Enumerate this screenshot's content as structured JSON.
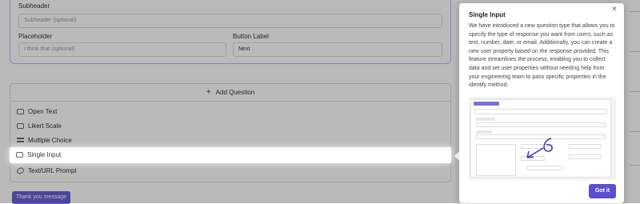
{
  "form": {
    "subheader_label": "Subheader",
    "subheader_placeholder": "Subheader (optional)",
    "placeholder_label": "Placeholder",
    "placeholder_placeholder": "I think that (optional)",
    "button_label_label": "Button Label",
    "button_label_value": "Next"
  },
  "question_types": {
    "add_question_label": "Add Question",
    "items": [
      {
        "label": "Open Text",
        "icon": "text-box-icon"
      },
      {
        "label": "Likert Scale",
        "icon": "scale-icon"
      },
      {
        "label": "Multiple Choice",
        "icon": "list-icon"
      },
      {
        "label": "Single Input",
        "icon": "input-icon"
      },
      {
        "label": "Text/URL Prompt",
        "icon": "link-icon"
      }
    ]
  },
  "thank_you_button": "Thank you message",
  "popover": {
    "title": "Single Input",
    "body": "We have introduced a new question type that allows you to specify the type of response you want from users, such as text, number, date, or email. Additionally, you can create a new user property based on the response provided. This feature streamlines the process, enabling you to collect data and set user properties without needing help from your engineering team to pass specific properties in the identify method.",
    "got_it": "Got it",
    "close_glyph": "×"
  },
  "colors": {
    "accent": "#5b4fcf",
    "card_border": "#b9b3f0",
    "overlay": "rgba(0,0,0,0.27)"
  }
}
